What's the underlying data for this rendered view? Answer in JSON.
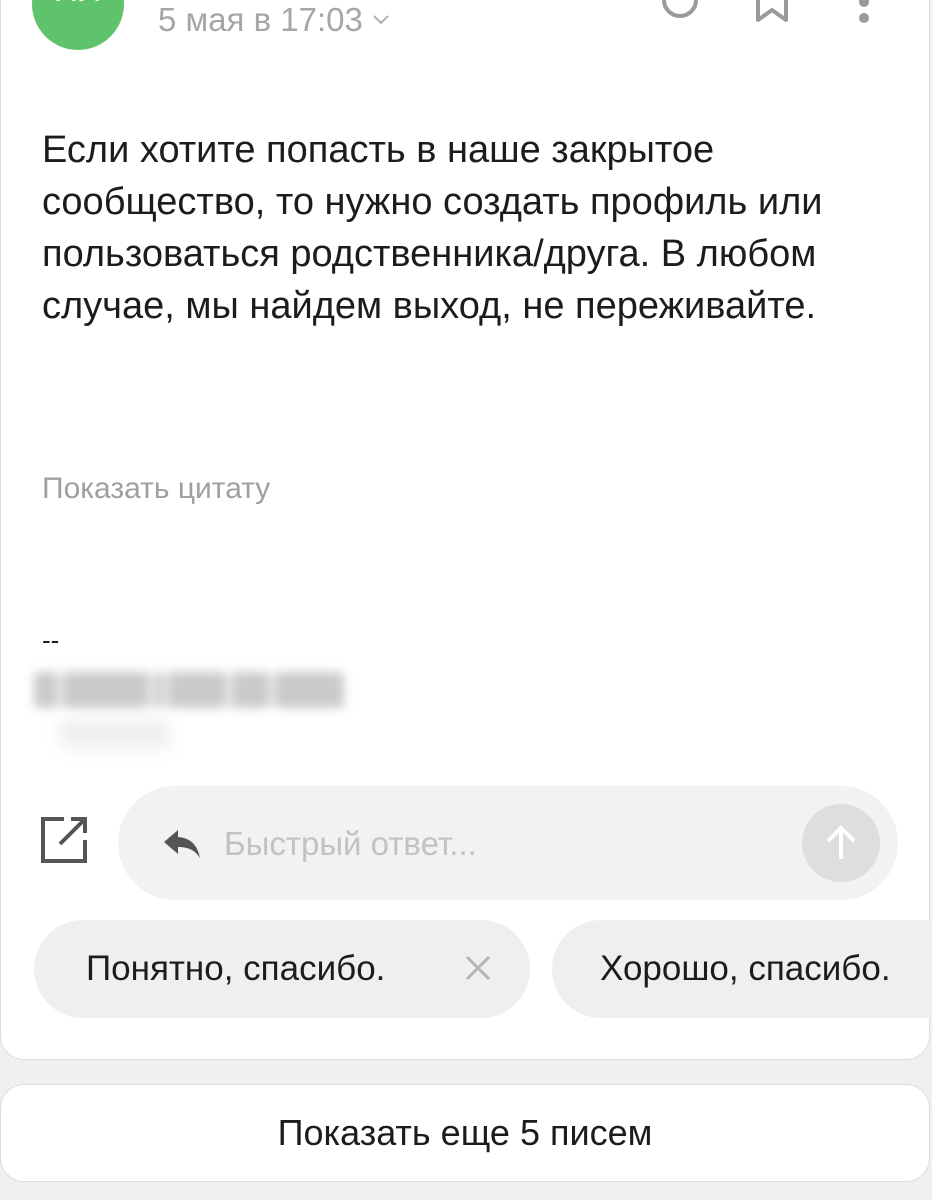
{
  "header": {
    "avatar_initials": "НЛ",
    "avatar_color": "#5ec36b",
    "date": "5 мая в 17:03",
    "icons": [
      "chevron-down-icon",
      "circle-icon",
      "bookmark-icon",
      "more-vertical-icon"
    ]
  },
  "message": {
    "body": "Если хотите попасть в наше закрытое сообщество, то нужно создать профиль или пользоваться родственника/друга. В любом случае, мы найдем выход, не переживайте.",
    "show_quote": "Показать цитату",
    "signature_dash": "--"
  },
  "reply": {
    "placeholder": "Быстрый ответ...",
    "icons": [
      "compose-icon",
      "reply-icon",
      "send-arrow-up-icon"
    ]
  },
  "suggestions": [
    {
      "label": "Понятно, спасибо."
    },
    {
      "label": "Хорошо, спасибо."
    }
  ],
  "show_more": "Показать еще 5 писем",
  "colors": {
    "text": "#1c1c1c",
    "muted": "#a6a6a6",
    "chip_bg": "#efefef",
    "page_bg": "#f0f0f0"
  }
}
